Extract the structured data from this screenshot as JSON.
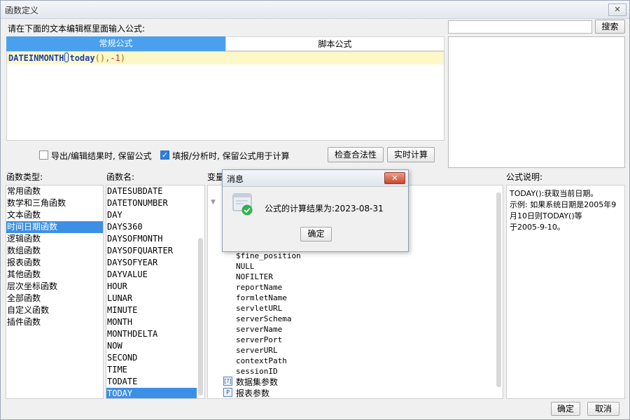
{
  "window": {
    "title": "函数定义",
    "close_glyph": "✕"
  },
  "prompt": "请在下面的文本编辑框里面输入公式:",
  "search": {
    "value": "",
    "button_label": "搜索"
  },
  "tabs": [
    {
      "label": "常规公式"
    },
    {
      "label": "脚本公式"
    }
  ],
  "formula": {
    "func": "DATEINMONTH",
    "open": "(",
    "inner": "today",
    "inner_parens": "()",
    "sep": ",",
    "arg": "-1",
    "close": ")"
  },
  "options": {
    "keep_on_export_label": "导出/编辑结果时, 保留公式",
    "keep_on_export_checked": false,
    "keep_on_fill_label": "填报/分析时, 保留公式用于计算",
    "keep_on_fill_checked": true,
    "check_button_label": "检查合法性",
    "realtime_button_label": "实时计算"
  },
  "sections": {
    "func_type": "函数类型:",
    "func_name": "函数名:",
    "variables": "变量",
    "description": "公式说明:"
  },
  "func_types": [
    "常用函数",
    "数学和三角函数",
    "文本函数",
    "时间日期函数",
    "逻辑函数",
    "数组函数",
    "报表函数",
    "其他函数",
    "层次坐标函数",
    "全部函数",
    "自定义函数",
    "插件函数"
  ],
  "func_types_selected": 3,
  "func_names": [
    "DATESUBDATE",
    "DATETONUMBER",
    "DAY",
    "DAYS360",
    "DAYSOFMONTH",
    "DAYSOFQUARTER",
    "DAYSOFYEAR",
    "DAYVALUE",
    "HOUR",
    "LUNAR",
    "MINUTE",
    "MONTH",
    "MONTHDELTA",
    "NOW",
    "SECOND",
    "TIME",
    "TODATE",
    "TODAY"
  ],
  "func_names_selected": 17,
  "variables": [
    "$fine_position",
    "NULL",
    "NOFILTER",
    "reportName",
    "formletName",
    "servletURL",
    "serverSchema",
    "serverName",
    "serverPort",
    "serverURL",
    "contextPath",
    "sessionID"
  ],
  "tree_groups": [
    {
      "label": "数据集参数",
      "icon": "dataset-param-icon",
      "glyph": "[?]"
    },
    {
      "label": "报表参数",
      "icon": "report-param-icon",
      "glyph": "P"
    }
  ],
  "description": {
    "lines": [
      "TODAY():获取当前日期。",
      "示例: 如果系统日期是2005年9",
      "月10日则TODAY()等",
      "于2005-9-10。"
    ]
  },
  "footer": {
    "ok_label": "确定",
    "cancel_label": "取消"
  },
  "dialog": {
    "title": "消息",
    "close_glyph": "✕",
    "message": "公式的计算结果为:2023-08-31",
    "ok_label": "确定",
    "icon": "success-check-icon"
  },
  "colors": {
    "accent": "#4aa0ee",
    "selection": "#3d8fe6",
    "editor_line": "#fdf8c8",
    "success": "#2db34a"
  }
}
